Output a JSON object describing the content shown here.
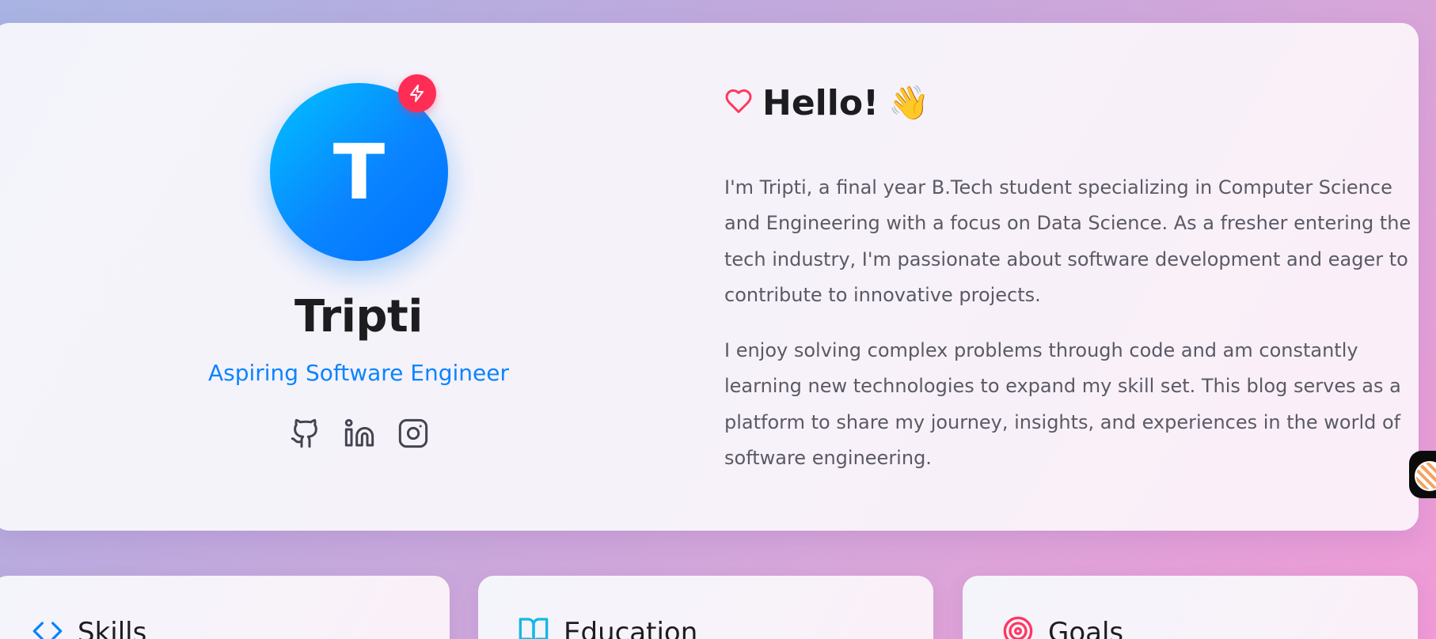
{
  "profile": {
    "avatar_initial": "T",
    "name": "Tripti",
    "role": "Aspiring Software Engineer",
    "badge_icon": "lightning-icon",
    "socials": [
      {
        "name": "github",
        "icon": "github-icon"
      },
      {
        "name": "linkedin",
        "icon": "linkedin-icon"
      },
      {
        "name": "instagram",
        "icon": "instagram-icon"
      }
    ]
  },
  "about": {
    "title": "Hello!",
    "title_icon": "heart-icon",
    "emoji": "👋",
    "paragraphs": [
      "I'm Tripti, a final year B.Tech student specializing in Computer Science and Engineering with a focus on Data Science. As a fresher entering the tech industry, I'm passionate about software development and eager to contribute to innovative projects.",
      "I enjoy solving complex problems through code and am constantly learning new technologies to expand my skill set. This blog serves as a platform to share my journey, insights, and experiences in the world of software engineering."
    ]
  },
  "cards": [
    {
      "title": "Skills",
      "icon": "code-icon"
    },
    {
      "title": "Education",
      "icon": "book-icon"
    },
    {
      "title": "Goals",
      "icon": "target-icon"
    }
  ],
  "colors": {
    "accent": "#0a84ff",
    "badge": "#ff2d55",
    "heart": "#ff375f",
    "text_primary": "#1d1d1f",
    "text_secondary": "#5a5a66"
  }
}
